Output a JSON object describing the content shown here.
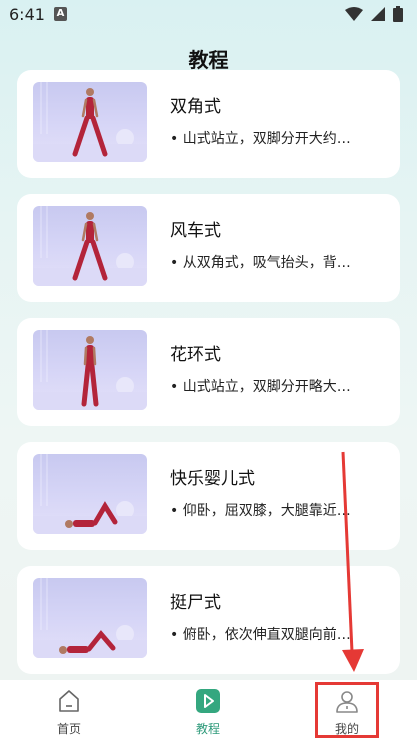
{
  "status_bar": {
    "time": "6:41",
    "app_icon_label": "A"
  },
  "header": {
    "title": "教程"
  },
  "cards": [
    {
      "title": "双角式",
      "desc": "• 山式站立，双脚分开大约…",
      "pose": "standing-wide"
    },
    {
      "title": "风车式",
      "desc": "• 从双角式，吸气抬头，背…",
      "pose": "standing-wide"
    },
    {
      "title": "花环式",
      "desc": "• 山式站立，双脚分开略大…",
      "pose": "standing"
    },
    {
      "title": "快乐婴儿式",
      "desc": "• 仰卧，屈双膝，大腿靠近…",
      "pose": "lying"
    },
    {
      "title": "挺尸式",
      "desc": "• 俯卧，依次伸直双腿向前…",
      "pose": "lying"
    }
  ],
  "tabbar": {
    "home": {
      "label": "首页",
      "icon": "home-icon"
    },
    "tutorial": {
      "label": "教程",
      "icon": "play-icon"
    },
    "mine": {
      "label": "我的",
      "icon": "person-icon"
    }
  },
  "colors": {
    "accent": "#2e9a7a",
    "annotation": "#e53935"
  }
}
